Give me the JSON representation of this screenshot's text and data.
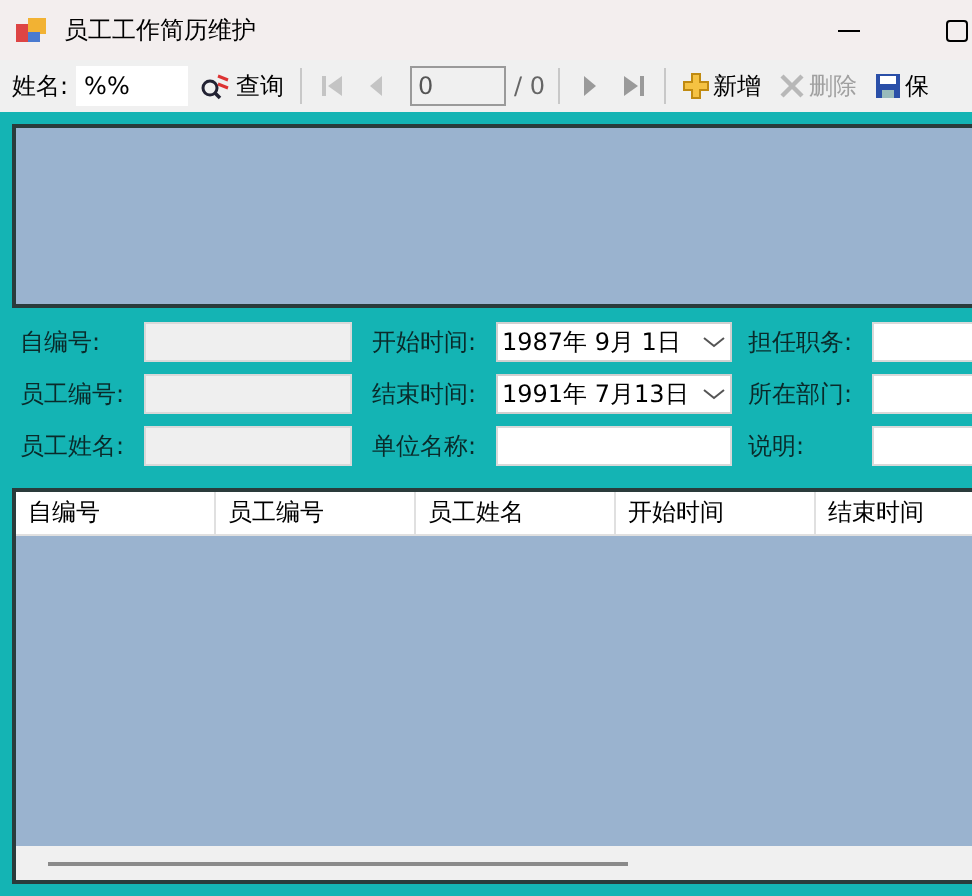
{
  "window": {
    "title": "员工工作简历维护"
  },
  "toolbar": {
    "name_label": "姓名:",
    "name_value": "%%",
    "search_label": "查询",
    "nav": [
      {
        "kind": "first",
        "disabled": true
      },
      {
        "kind": "prev",
        "disabled": true
      },
      {
        "kind": "position",
        "value": "0"
      },
      {
        "kind": "count",
        "text": "/ 0"
      },
      {
        "kind": "next",
        "disabled": false
      },
      {
        "kind": "last",
        "disabled": false
      }
    ],
    "actions": [
      {
        "kind": "add",
        "label": "新增",
        "disabled": false
      },
      {
        "kind": "delete",
        "label": "删除",
        "disabled": true
      },
      {
        "kind": "save",
        "label": "保",
        "disabled": false
      }
    ]
  },
  "form": {
    "columns": [
      [
        {
          "label": "自编号:",
          "kind": "text",
          "readonly": true
        },
        {
          "label": "员工编号:",
          "kind": "text",
          "readonly": true
        },
        {
          "label": "员工姓名:",
          "kind": "text",
          "readonly": true
        }
      ],
      [
        {
          "label": "开始时间:",
          "kind": "date",
          "value": "1987年 9月 1日"
        },
        {
          "label": "结束时间:",
          "kind": "date",
          "value": "1991年 7月13日"
        },
        {
          "label": "单位名称:",
          "kind": "text",
          "readonly": false
        }
      ],
      [
        {
          "label": "担任职务:",
          "kind": "text",
          "readonly": false
        },
        {
          "label": "所在部门:",
          "kind": "text",
          "readonly": false
        },
        {
          "label": "说明:",
          "kind": "text",
          "readonly": false
        }
      ]
    ]
  },
  "table": {
    "columns": [
      "自编号",
      "员工编号",
      "员工姓名",
      "开始时间",
      "结束时间"
    ]
  }
}
